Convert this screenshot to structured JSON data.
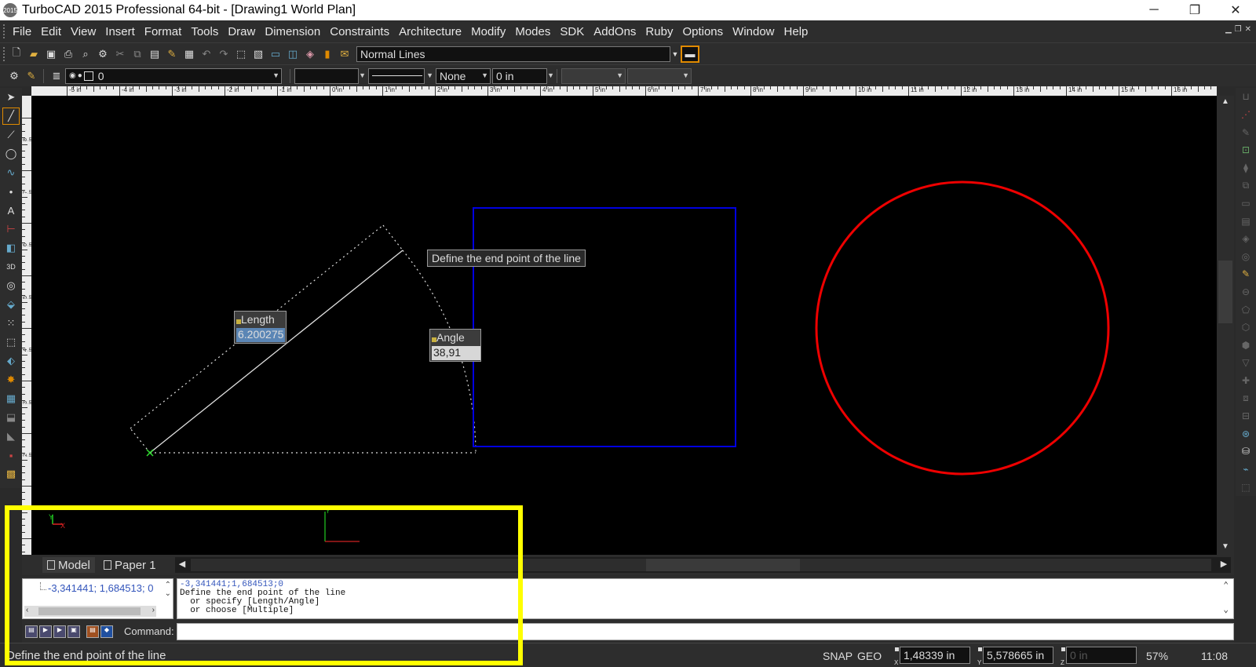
{
  "window": {
    "title": "TurboCAD 2015 Professional 64-bit - [Drawing1 World Plan]",
    "app_icon_text": "2015",
    "minimize": "─",
    "maximize": "❐",
    "close": "✕"
  },
  "menu": [
    "File",
    "Edit",
    "View",
    "Insert",
    "Format",
    "Tools",
    "Draw",
    "Dimension",
    "Constraints",
    "Architecture",
    "Modify",
    "Modes",
    "SDK",
    "AddOns",
    "Ruby",
    "Options",
    "Window",
    "Help"
  ],
  "toolbar1": {
    "line_style": "Normal Lines"
  },
  "toolbar2": {
    "layer": "0",
    "pen_style": "None",
    "width": "0 in"
  },
  "ruler": {
    "h_labels": [
      "-5 in",
      "-4 in",
      "-3 in",
      "-2 in",
      "-1 in",
      "0 in",
      "1 in",
      "2 in",
      "3 in",
      "4 in",
      "5 in",
      "6 in",
      "7 in",
      "8 in",
      "9 in",
      "10 in",
      "11 in",
      "12 in",
      "13 in",
      "14 in",
      "15 in",
      "16 in"
    ],
    "v_labels": [
      "8 in",
      "7 in",
      "6 in",
      "5 in",
      "4 in",
      "3 in",
      "2 in",
      "1 in",
      "0 in"
    ]
  },
  "canvas": {
    "prompt_tooltip": "Define the end point of the line",
    "length_label": "Length",
    "length_value": "6.200275",
    "angle_label": "Angle",
    "angle_value": "38,91",
    "axis_y": "Y",
    "axis_x": "X",
    "colors": {
      "rectangle": "#0000e0",
      "circle": "#ee0000",
      "line": "#e0e0e0",
      "guide": "#dddddd"
    }
  },
  "tabs": {
    "model": "Model",
    "paper": "Paper 1"
  },
  "command": {
    "coordinate_item": "-3,341441; 1,684513; 0",
    "history": [
      "-3,341441;1,684513;0",
      "Define the end point of the line",
      "  or specify [Length/Angle]",
      "  or choose [Multiple]"
    ],
    "label": "Command:"
  },
  "status": {
    "message": "Define the end point of the line",
    "snap": "SNAP",
    "geo": "GEO",
    "x_value": "1,48339 in",
    "y_value": "5,578665 in",
    "z_value": "0 in",
    "x_axis": "X",
    "y_axis": "Y",
    "z_axis": "Z",
    "zoom": "57%",
    "time": "11:08"
  },
  "highlight_color": "#ffff00"
}
